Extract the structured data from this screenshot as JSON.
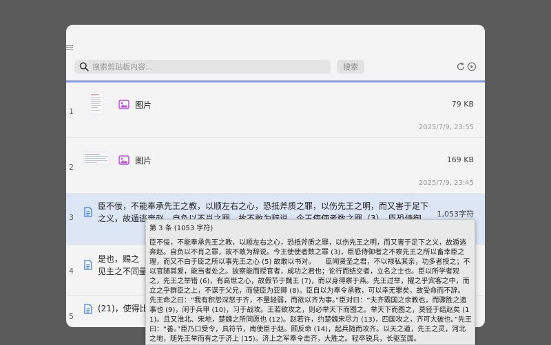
{
  "search": {
    "placeholder": "搜索剪贴板内容...",
    "button_label": "搜索"
  },
  "items": [
    {
      "index": "1",
      "type_label": "图片",
      "size": "79 KB",
      "date": "2025/7/9, 23:55"
    },
    {
      "index": "2",
      "type_label": "图片",
      "size": "169 KB",
      "date": "2025/7/9, 23:45"
    },
    {
      "index": "3",
      "text_line1": "臣不佞，不能奉承先王之教，以顺左右之心，恐抵斧质之罪，以伤先王之明，而又害于足下",
      "text_line2": "之义，故遁逃奔赵。自负以不肖之罪，故不敢为辞说。今王使使者数之罪（3），臣恐侍御",
      "size": "1,053字符"
    },
    {
      "index": "4",
      "text_line1": "是也，赐之",
      "text_line2": "见主之不同量"
    },
    {
      "index": "5",
      "text_line1": "(21)，使得比"
    }
  ],
  "tooltip": {
    "title": "第 3 条 (1053 字符)",
    "body": "臣不佞，不能奉承先王之教，以顺左右之心，恐抵斧质之罪，以伤先王之明，而又害于足下之义，故遁逃奔赵。自负以不肖之罪，故不敢为辞说。今王使使者数之罪 (3)，臣恐侍御者之不察先王之所以畜幸臣之理，而又不白于臣之所以事先王之心 (5) 故敢以书对。　　臣闻贤圣之君，不以禄私其亲，功多者授之；不以官随其爱，能当者处之。故察能而授官者，成功之君也；论行而结交者，立名之士也。臣以所学者观之，先王之举错 (6)，有高世之心，故假节于魏王 (7)，而以身得察于燕。先王过举，擢之乎宾客之中，而立之乎群臣之上，不谋于父兄，而使臣为亚卿 (8)。臣自以为奉令承教，可以幸无罪矣，故受命而不辞。　　先王命之曰：“我有积怨深怒于齐，不量轻弱，而欲以齐为事。”臣对曰：“夫齐霸国之余教也，而骤胜之遗事也 (9)，闲于兵甲 (10)，习于战攻。王若欲攻之，则必举天下而图之。举天下而图之，莫径于结赵矣 (11)。且又淮北、宋地，楚魏之所同愿也 (12)。赵若许，约楚魏宋尽力 (13)，四国攻之，齐可大破也。”先王曰：“善。”臣乃口受令，具符节，南使臣于赵。顾反命 (14)，起兵随而攻齐。以天之道，先王之灵，河北之地，随先王举而有之于济上 (15)。济上之军奉令击齐，大胜之。轻卒锐兵，长驱至国。"
  }
}
